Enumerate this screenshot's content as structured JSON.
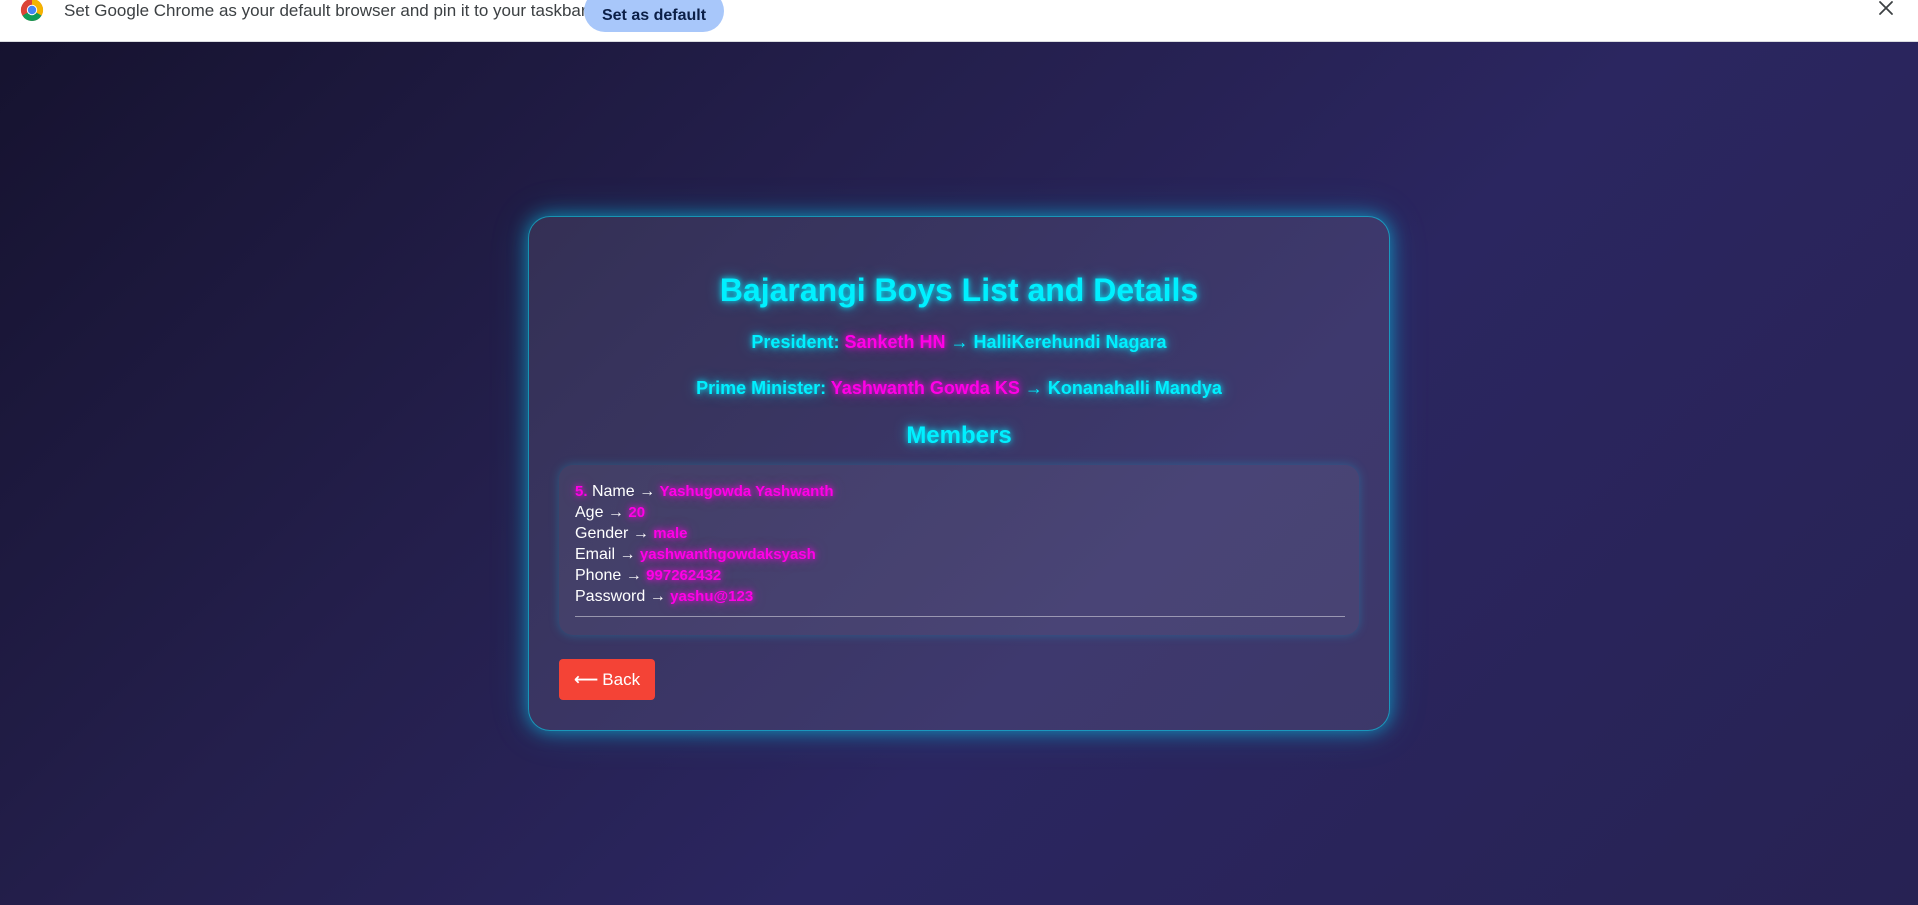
{
  "infobar": {
    "message": "Set Google Chrome as your default browser and pin it to your taskbar",
    "button_label": "Set as default",
    "close_glyph": "×"
  },
  "page": {
    "title": "Bajarangi Boys List and Details",
    "president": {
      "label": "President: ",
      "name": "Sanketh HN",
      "arrow": " → ",
      "place": "HalliKerehundi Nagara"
    },
    "prime_minister": {
      "label": "Prime Minister: ",
      "name": "Yashwanth Gowda KS",
      "arrow": " → ",
      "place": "Konanahalli Mandya"
    },
    "members_heading": "Members"
  },
  "member": {
    "index": "5.",
    "fields": [
      {
        "label": "Name →",
        "value": "Yashugowda Yashwanth"
      },
      {
        "label": "Age →",
        "value": "20"
      },
      {
        "label": "Gender →",
        "value": "male"
      },
      {
        "label": "Email →",
        "value": "yashwanthgowdaksyash"
      },
      {
        "label": "Phone →",
        "value": "997262432"
      },
      {
        "label": "Password →",
        "value": "yashu@123"
      }
    ]
  },
  "back_button": {
    "arrow": "⟵",
    "label": "Back",
    "color": "#f44336"
  },
  "colors": {
    "neon_cyan": "#00f0ff",
    "neon_pink": "#ff00e6",
    "chrome_button": "#a8c7fa"
  },
  "icons": {
    "chrome_logo": "chrome-logo-icon",
    "close": "close-icon"
  }
}
